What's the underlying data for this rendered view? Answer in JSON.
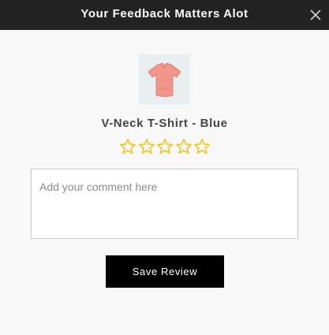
{
  "header": {
    "title": "Your Feedback Matters Alot",
    "close_icon": "close-icon"
  },
  "product": {
    "name": "V-Neck T-Shirt - Blue",
    "image_icon": "tshirt-icon",
    "image_color": "#f2958a"
  },
  "rating": {
    "max_stars": 5,
    "selected": 0,
    "star_color": "#f5c518",
    "star_icon": "star-outline-icon"
  },
  "comment": {
    "value": "",
    "placeholder": "Add your comment here"
  },
  "actions": {
    "save_label": "Save Review"
  }
}
